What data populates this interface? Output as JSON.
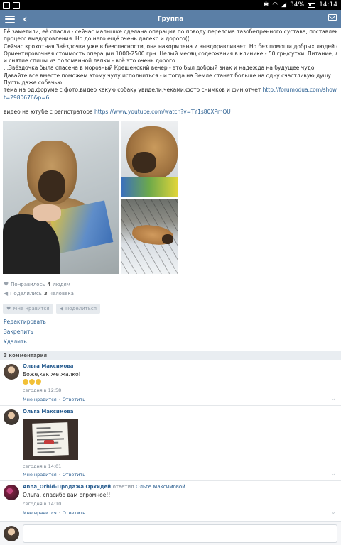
{
  "status_bar": {
    "battery": "34%",
    "time": "14:14"
  },
  "header": {
    "title": "Группа"
  },
  "post": {
    "lines": [
      "Её заметили, её спасли - сейчас малышке сделана операция по поводу перелома тазобедренного сустава, поставлена спица и начат",
      "процесс выздоровления. Но до него ещё очень далеко и дорого((",
      "Сейчас крохотная Звёздочка уже в безопасности, она накормлена и выздоравливает. Но без помощи добрых людей ей не справиться...",
      "Ориентировочная стоимость операции 1000-2500 грн. Целый месяц содержания в клинике - 50 грн/сутки. Питание, лекарства, прививки",
      "и снятие спицы из поломанной лапки - всё это очень дорого...",
      "...Звёздочка была спасена в морозный Крещенский вечер - это был добрый знак и надежда на будущее чудо.",
      "Давайте все вместе поможем этому чуду исполниться - и тогда на Земле станет больше на одну счастливую душу.",
      "Пусть даже собачью..."
    ],
    "forum_text": "тема на од.форуме с фото,видео какую собаку увидели,чеками,фото снимков и фин.отчет ",
    "forum_link_line1": "http://forumodua.com/showthread.php?",
    "forum_link_line2": "t=2980676&p=6...",
    "video_text": "видео на ютубе с регистратора ",
    "video_link": "https://www.youtube.com/watch?v=TY1s80XPmQU",
    "likes_prefix": "Понравилось ",
    "likes_count": "4",
    "likes_suffix": " людям",
    "shares_prefix": "Поделились ",
    "shares_count": "3",
    "shares_suffix": " человека"
  },
  "actions": {
    "like": "Мне нравится",
    "share": "Поделиться"
  },
  "admin": {
    "edit": "Редактировать",
    "pin": "Закрепить",
    "delete": "Удалить"
  },
  "comments": {
    "header": "3 комментария",
    "items": [
      {
        "author": "Ольга Максимова",
        "text": "Боже,как же жалко!",
        "time": "сегодня в 12:58",
        "like": "Мне нравится",
        "reply": "Ответить"
      },
      {
        "author": "Ольга Максимова",
        "time": "сегодня в 14:01",
        "like": "Мне нравится",
        "reply": "Ответить"
      },
      {
        "author": "Anna_Orhid-Продажа Орхидей",
        "replied_to_label": "ответил",
        "replied_to": "Ольге Максимовой",
        "text": "Ольга, спасибо вам огромное!!",
        "time": "сегодня в 14:10",
        "like": "Мне нравится",
        "reply": "Ответить"
      }
    ],
    "separator": "·"
  }
}
